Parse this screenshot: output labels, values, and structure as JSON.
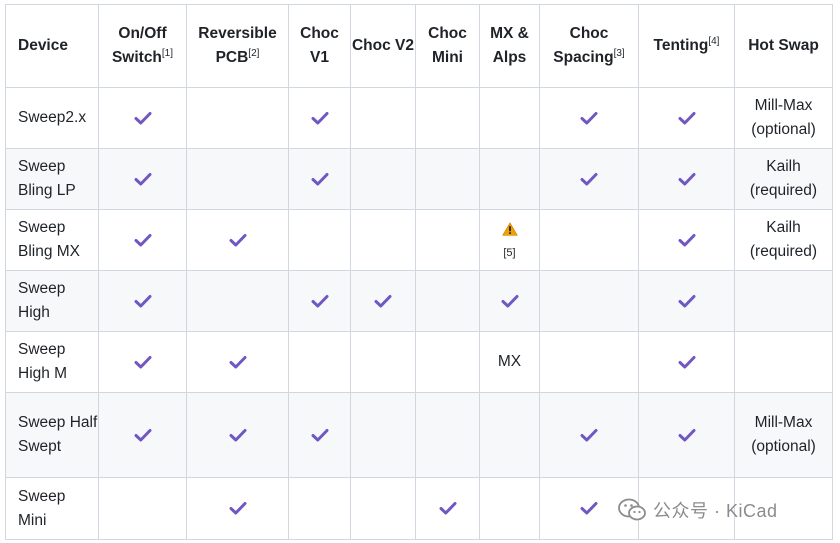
{
  "headers": [
    {
      "text": "Device",
      "sup": ""
    },
    {
      "text": "On/Off Switch",
      "sup": "[1]"
    },
    {
      "text": "Reversible PCB",
      "sup": "[2]"
    },
    {
      "text": "Choc V1",
      "sup": ""
    },
    {
      "text": "Choc V2",
      "sup": ""
    },
    {
      "text": "Choc Mini",
      "sup": ""
    },
    {
      "text": "MX & Alps",
      "sup": ""
    },
    {
      "text": "Choc Spacing",
      "sup": "[3]"
    },
    {
      "text": "Tenting",
      "sup": "[4]"
    },
    {
      "text": "Hot Swap",
      "sup": ""
    }
  ],
  "rows": [
    {
      "device": "Sweep2.x",
      "cells": [
        "check",
        "",
        "check",
        "",
        "",
        "",
        "check",
        "check",
        "Mill-Max (optional)"
      ]
    },
    {
      "device": "Sweep Bling LP",
      "cells": [
        "check",
        "",
        "check",
        "",
        "",
        "",
        "check",
        "check",
        "Kailh (required)"
      ]
    },
    {
      "device": "Sweep Bling MX",
      "cells": [
        "check",
        "check",
        "",
        "",
        "",
        "warn",
        "",
        "check",
        "Kailh (required)"
      ]
    },
    {
      "device": "Sweep High",
      "cells": [
        "check",
        "",
        "check",
        "check",
        "",
        "check",
        "",
        "check",
        ""
      ]
    },
    {
      "device": "Sweep High M",
      "cells": [
        "check",
        "check",
        "",
        "",
        "",
        "MX",
        "",
        "check",
        ""
      ]
    },
    {
      "device": "Sweep Half Swept",
      "cells": [
        "check",
        "check",
        "check",
        "",
        "",
        "",
        "check",
        "check",
        "Mill-Max (optional)"
      ]
    },
    {
      "device": "Sweep Mini",
      "cells": [
        "",
        "check",
        "",
        "",
        "check",
        "",
        "check",
        "",
        ""
      ]
    }
  ],
  "warn_note": "[5]",
  "watermark": {
    "text": "公众号 · KiCad",
    "icon": "wechat-icon"
  },
  "colors": {
    "check": "#7057c2",
    "warn": "#f0a000",
    "border": "#d0d7de",
    "alt_row": "#f6f8fa"
  }
}
